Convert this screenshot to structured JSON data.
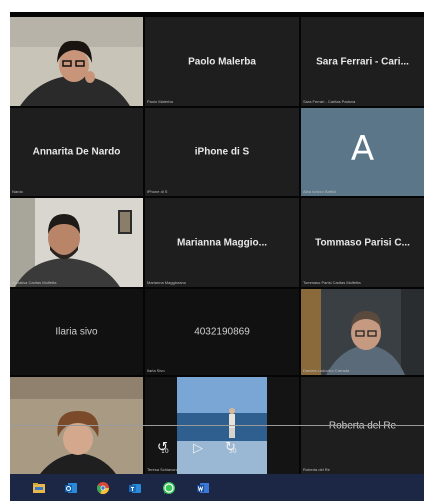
{
  "participants": {
    "paolo": {
      "name": "Paolo Malerba",
      "small": "Paolo Malerba"
    },
    "sara": {
      "name": "Sara Ferrari - Cari...",
      "small": "Sara Ferrari - Caritas Padova"
    },
    "annarita": {
      "name": "Annarita De Nardo",
      "small": "Nardo"
    },
    "iphone": {
      "name": "iPhone di S",
      "small": "iPhone di S"
    },
    "alba": {
      "avatar": "A",
      "small": "Alba Iorizzo Baffoli"
    },
    "video1": {
      "small": "Annalisa Caritas Molfetta"
    },
    "marianna": {
      "name": "Marianna Maggio...",
      "small": "Marianna Maggiorano"
    },
    "tommaso": {
      "name": "Tommaso Parisi C...",
      "small": "Tommaso Parisi Caritas Molfetta"
    },
    "ilaria": {
      "name": "Ilaria sivo"
    },
    "phone": {
      "name": "4032190869",
      "small": "Ilaria Sivo"
    },
    "video2": {
      "small": "Daniela Ludovico Carrada"
    },
    "video3": {
      "small": "Teresa Schiavone"
    },
    "roberta": {
      "name": "Roberta del Re",
      "small": "Roberta del Re"
    }
  },
  "media_controls": {
    "rewind": "10",
    "forward": "30"
  },
  "taskbar": {
    "icons": [
      "file-manager-icon",
      "outlook-icon",
      "chrome-icon",
      "teams-icon",
      "whatsapp-icon",
      "word-icon"
    ]
  },
  "colors": {
    "grid_bg": "#050505",
    "tile_bg": "#1e1e1e",
    "avatar_bg": "#5a7688",
    "taskbar_bg": "#1b2744"
  }
}
